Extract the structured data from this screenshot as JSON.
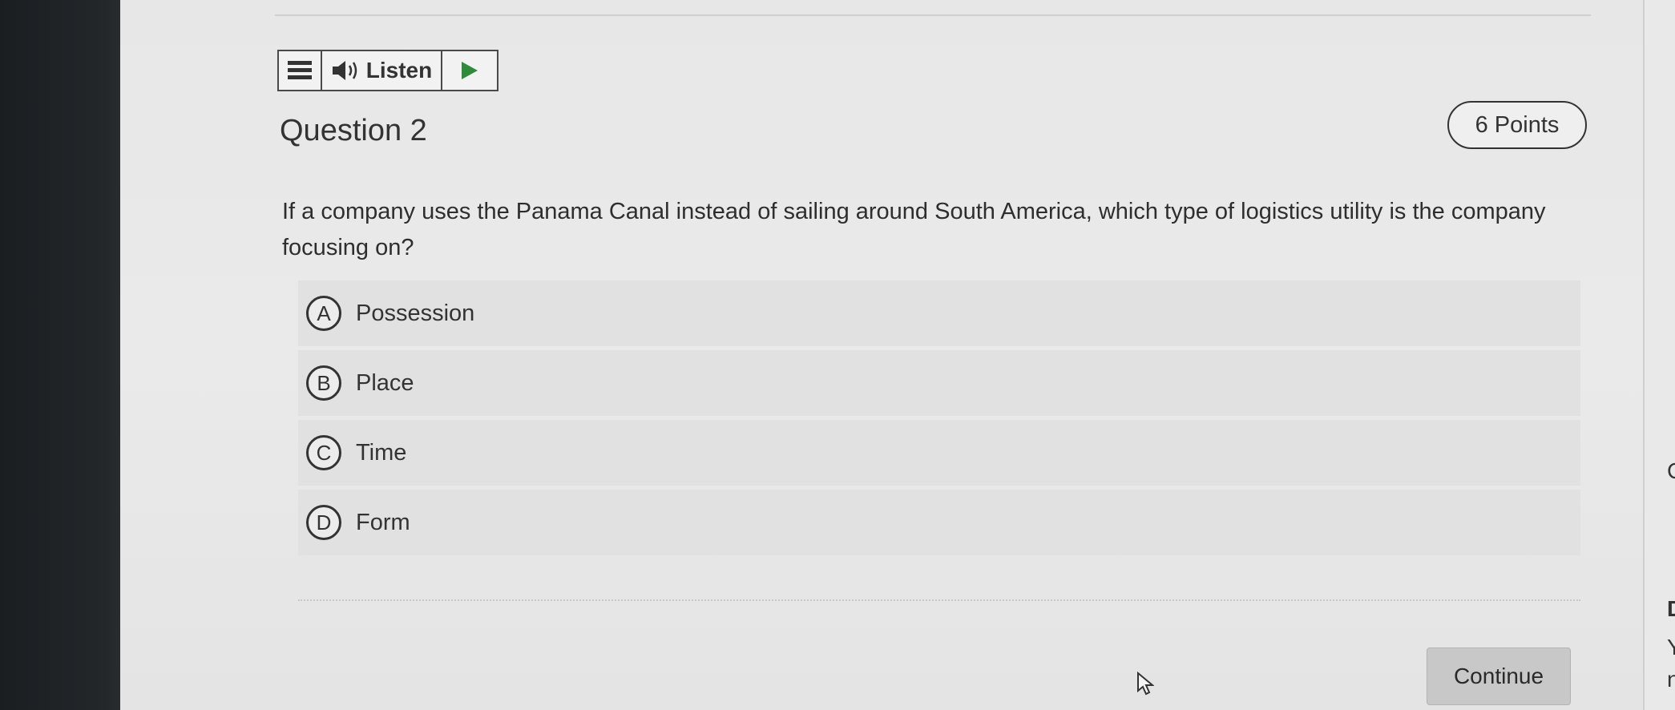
{
  "toolbar": {
    "menu_icon": "hamburger-menu-icon",
    "speaker_icon": "speaker-icon",
    "listen_label": "Listen",
    "play_icon": "play-icon",
    "play_color": "#2e8b3a"
  },
  "question": {
    "title": "Question 2",
    "points": "6 Points",
    "prompt": "If a company uses the Panama Canal instead of sailing around South America, which type of logistics utility is the company focusing on?"
  },
  "options": [
    {
      "letter": "A",
      "label": "Possession"
    },
    {
      "letter": "B",
      "label": "Place"
    },
    {
      "letter": "C",
      "label": "Time"
    },
    {
      "letter": "D",
      "label": "Form"
    }
  ],
  "footer": {
    "continue_label": "Continue"
  },
  "right_edge_fragments": [
    "C",
    "D",
    "Y",
    "n"
  ]
}
